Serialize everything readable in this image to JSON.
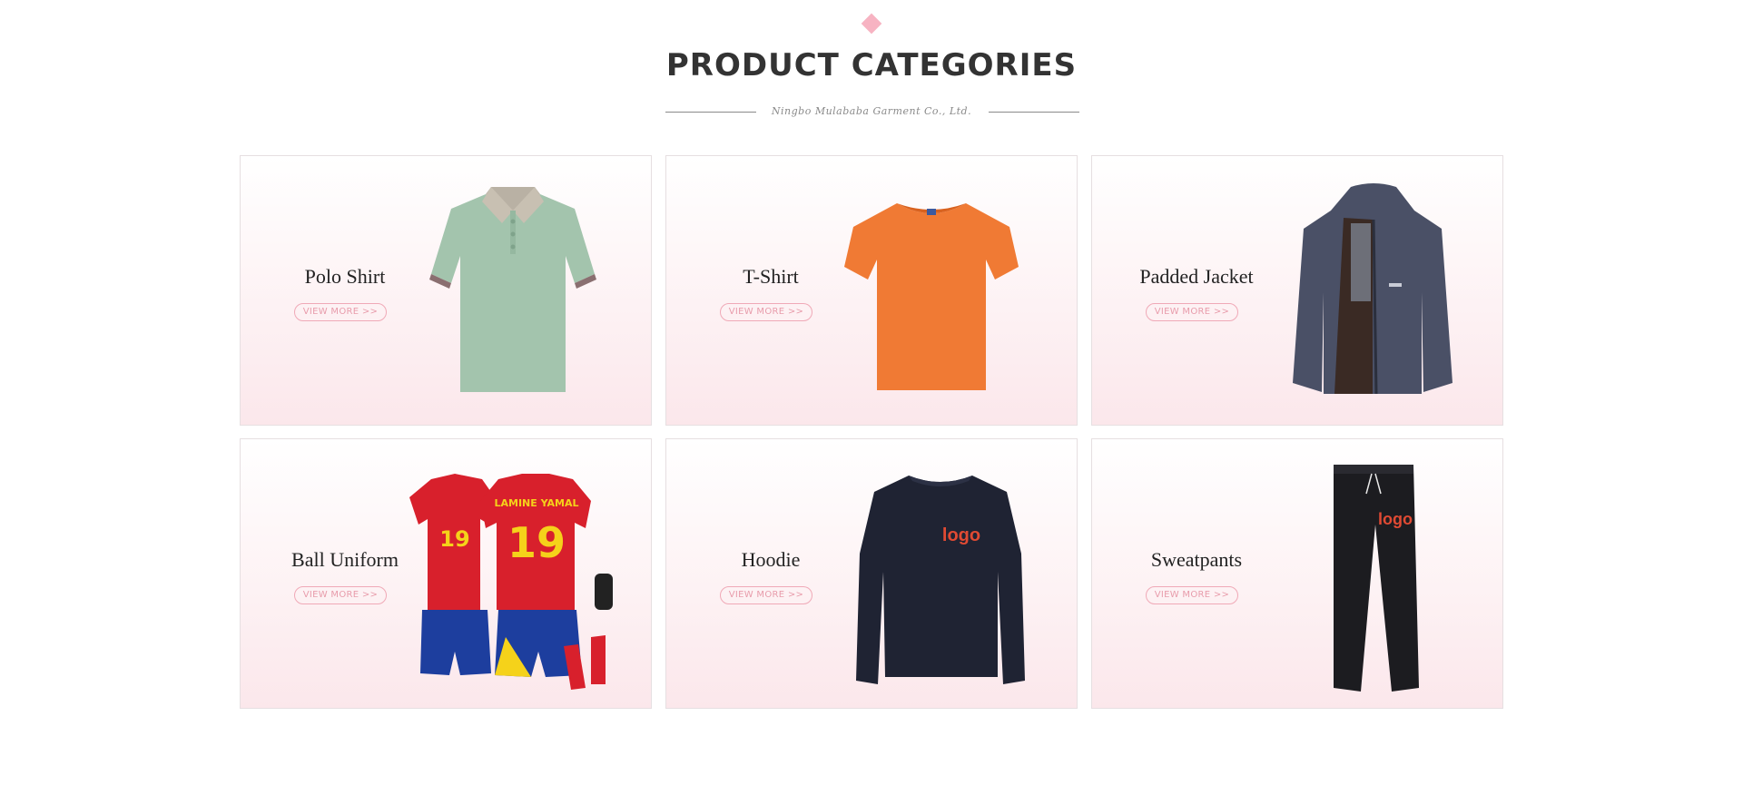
{
  "section": {
    "title": "PRODUCT CATEGORIES",
    "subtitle": "Ningbo Mulababa Garment Co., Ltd.",
    "accent_color": "#f7b3c2"
  },
  "categories": [
    {
      "name": "Polo Shirt",
      "button": "VIEW MORE >>",
      "image": "polo-shirt-icon"
    },
    {
      "name": "T-Shirt",
      "button": "VIEW MORE >>",
      "image": "t-shirt-icon"
    },
    {
      "name": "Padded Jacket",
      "button": "VIEW MORE >>",
      "image": "padded-jacket-icon"
    },
    {
      "name": "Ball Uniform",
      "button": "VIEW MORE >>",
      "image": "ball-uniform-icon",
      "print_name": "LAMINE YAMAL",
      "print_number": "19"
    },
    {
      "name": "Hoodie",
      "button": "VIEW MORE >>",
      "image": "hoodie-icon",
      "print_logo": "logo"
    },
    {
      "name": "Sweatpants",
      "button": "VIEW MORE >>",
      "image": "sweatpants-icon",
      "print_logo": "logo"
    }
  ]
}
